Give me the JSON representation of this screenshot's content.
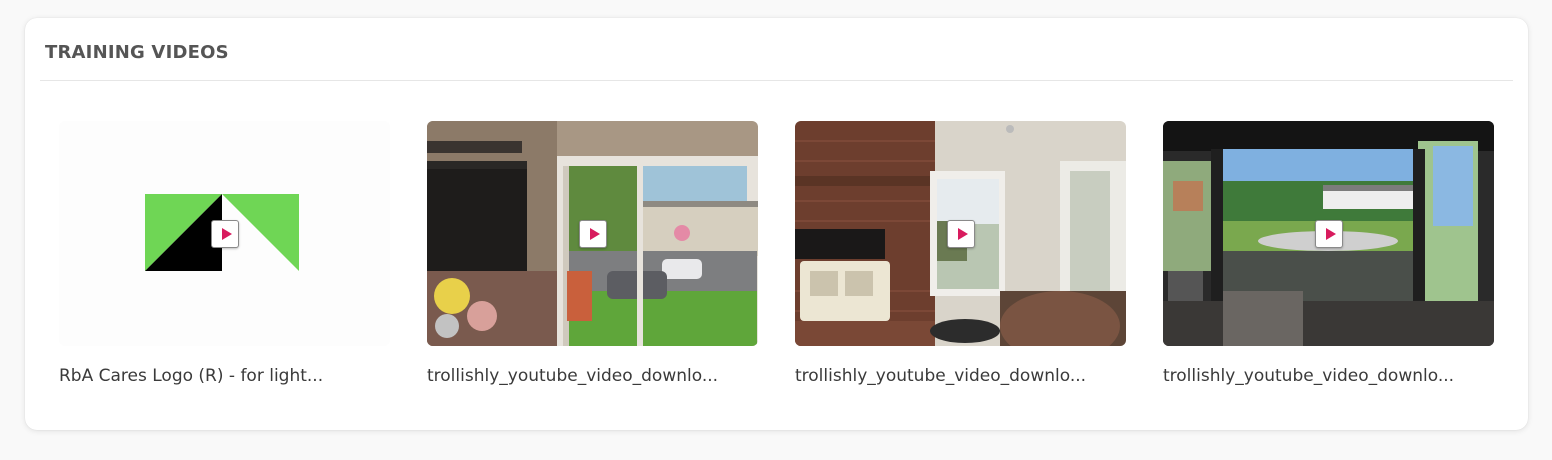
{
  "section": {
    "title": "TRAINING VIDEOS"
  },
  "videos": [
    {
      "title": "RbA Cares Logo (R) - for light...",
      "thumbnail": "logo",
      "play_icon": "play-icon"
    },
    {
      "title": "trollishly_youtube_video_downlo...",
      "thumbnail": "living-room-sliding-door",
      "play_icon": "play-icon"
    },
    {
      "title": "trollishly_youtube_video_downlo...",
      "thumbnail": "fireplace-room-window",
      "play_icon": "play-icon"
    },
    {
      "title": "trollishly_youtube_video_downlo...",
      "thumbnail": "bay-window-view",
      "play_icon": "play-icon"
    }
  ],
  "colors": {
    "play_accent": "#d81b5e",
    "logo_green": "#6fd655",
    "title_text": "#555555"
  }
}
